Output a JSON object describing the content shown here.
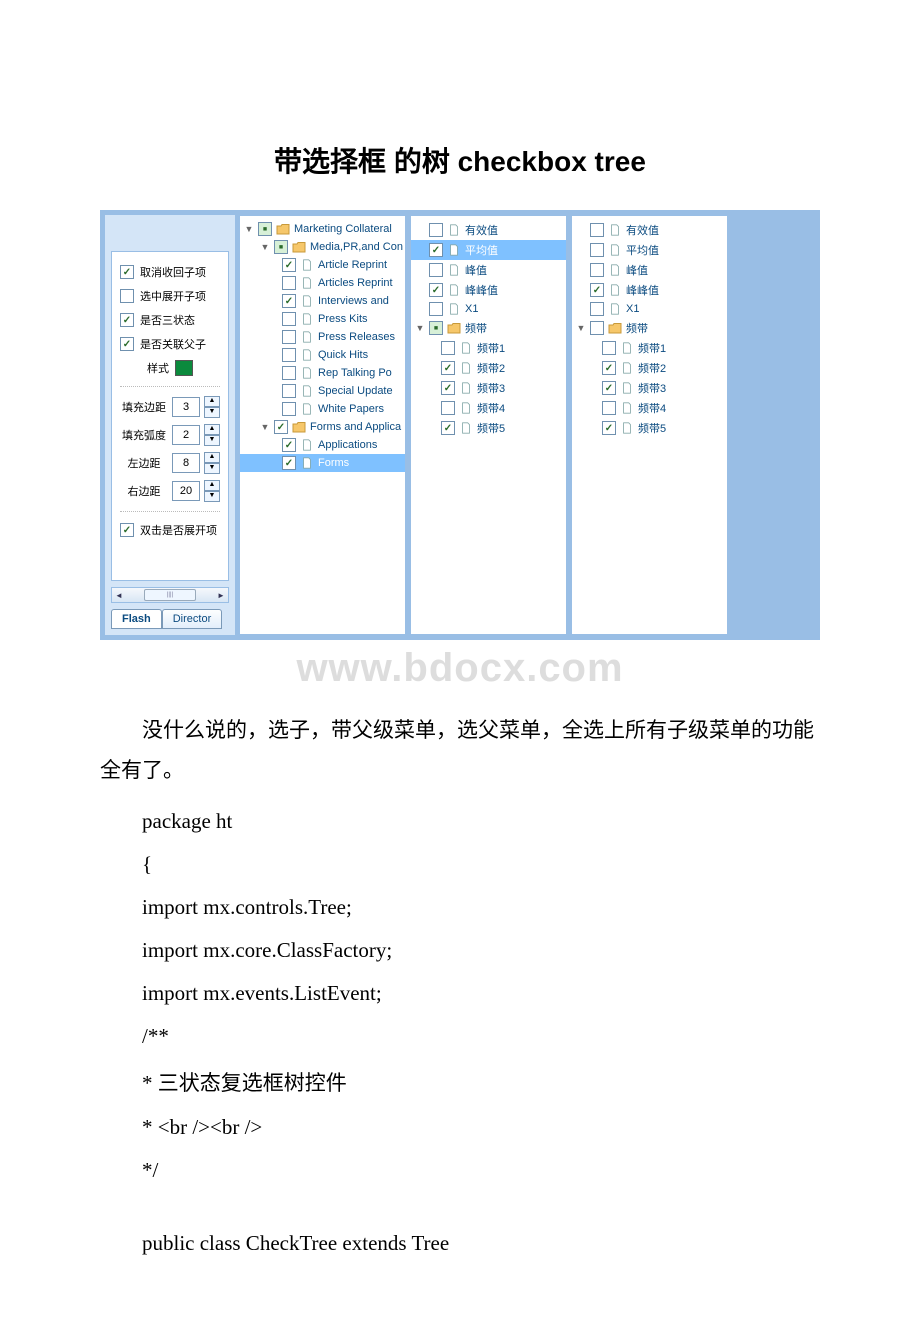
{
  "title": "带选择框 的树 checkbox tree",
  "watermark": "www.bdocx.com",
  "left_options": {
    "opt_collapse": "取消收回子项",
    "opt_expand": "选中展开子项",
    "opt_tristate": "是否三状态",
    "opt_parent_link": "是否关联父子",
    "opt_style": "样式",
    "opt_dblclick": "双击是否展开项",
    "num_pad_margin_label": "填充边距",
    "num_pad_margin_value": "3",
    "num_pad_arc_label": "填充弧度",
    "num_pad_arc_value": "2",
    "num_left_label": "左边距",
    "num_left_value": "8",
    "num_right_label": "右边距",
    "num_right_value": "20"
  },
  "tabs": {
    "flash": "Flash",
    "director": "Director"
  },
  "tree1": {
    "n0": "Marketing Collateral",
    "n1": "Media,PR,and Con",
    "n2": "Article Reprint",
    "n3": "Articles Reprint",
    "n4": "Interviews and",
    "n5": "Press Kits",
    "n6": "Press Releases",
    "n7": "Quick Hits",
    "n8": "Rep Talking Po",
    "n9": "Special Update",
    "n10": "White Papers",
    "n11": "Forms and Applica",
    "n12": "Applications",
    "n13": "Forms"
  },
  "tree_right": {
    "r0": "有效值",
    "r1": "平均值",
    "r2": "峰值",
    "r3": "峰峰值",
    "r4": "X1",
    "r5": "频带",
    "r6": "频带1",
    "r7": "频带2",
    "r8": "频带3",
    "r9": "频带4",
    "r10": "频带5"
  },
  "body_p1": "没什么说的，选子，带父级菜单，选父菜单，全选上所有子级菜单的功能全有了。",
  "code": {
    "l1": "package ht",
    "l2": "{",
    "l3": " import mx.controls.Tree;",
    "l4": " import mx.core.ClassFactory;",
    "l5": " import mx.events.ListEvent;",
    "l6": " /**",
    "l7": " * 三状态复选框树控件",
    "l8": " * <br /><br />",
    "l9": " */",
    "l10": " public class CheckTree extends Tree"
  }
}
